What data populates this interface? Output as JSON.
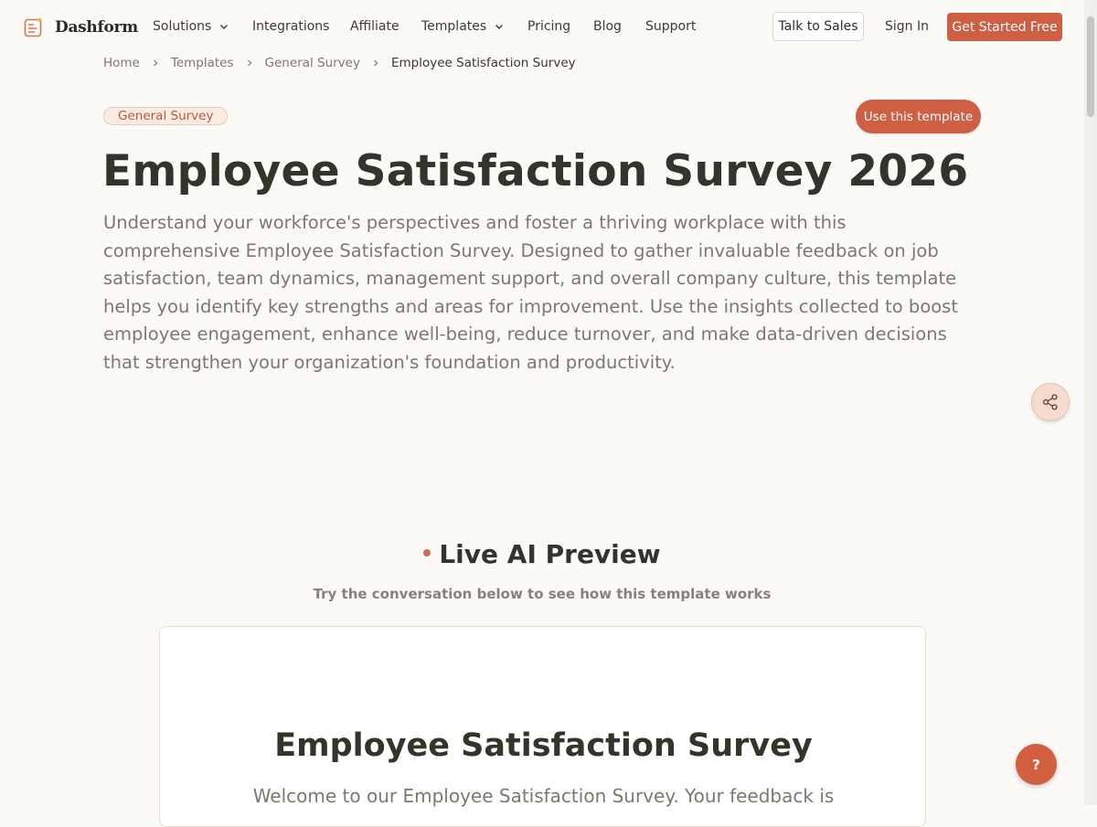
{
  "brand": {
    "name": "Dashform"
  },
  "nav": {
    "solutions": "Solutions",
    "integrations": "Integrations",
    "affiliate": "Affiliate",
    "templates": "Templates",
    "pricing": "Pricing",
    "blog": "Blog",
    "support": "Support",
    "talk_to_sales": "Talk to Sales",
    "sign_in": "Sign In",
    "get_started": "Get Started Free"
  },
  "breadcrumb": [
    "Home",
    "Templates",
    "General Survey",
    "Employee Satisfaction Survey"
  ],
  "category_badge": "General Survey",
  "use_template_label": "Use this template",
  "title": "Employee Satisfaction Survey 2026",
  "description": "Understand your workforce's perspectives and foster a thriving workplace with this comprehensive Employee Satisfaction Survey. Designed to gather invaluable feedback on job satisfaction, team dynamics, management support, and overall company culture, this template helps you identify key strengths and areas for improvement. Use the insights collected to boost employee engagement, enhance well-being, reduce turnover, and make data-driven decisions that strengthen your organization's foundation and productivity.",
  "preview": {
    "heading": "Live AI Preview",
    "subtitle": "Try the conversation below to see how this template works",
    "survey_title": "Employee Satisfaction Survey",
    "welcome_text": "Welcome to our Employee Satisfaction Survey. Your feedback is"
  },
  "help_label": "?",
  "colors": {
    "accent": "#cf5f43",
    "background": "#fcfaf7",
    "badge_bg": "#fbece3"
  },
  "icons": {
    "logo": "form-sparkle-icon",
    "share": "share-icon",
    "chevron": "chevron-down-icon",
    "separator": "chevron-right-icon"
  }
}
